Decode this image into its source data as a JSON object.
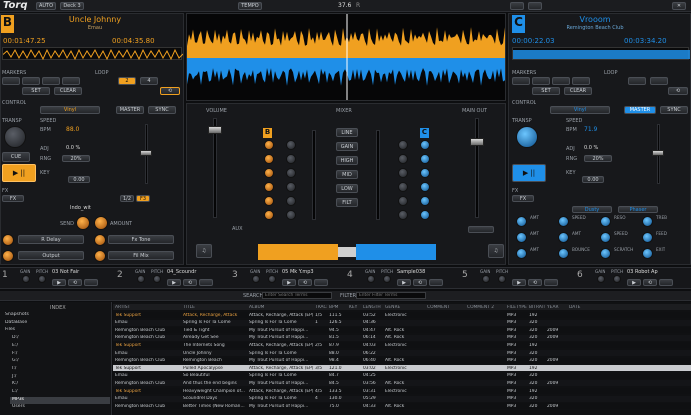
{
  "app": {
    "logo": "Torq",
    "menu": [
      "AUTO",
      "Deck 3"
    ],
    "tempo_label": "TEMPO",
    "bpm_display": "37.6",
    "tempo_sub": "R",
    "colors": {
      "orange": "#f0a020",
      "blue": "#1f8fe8",
      "bg": "#0d0e10"
    }
  },
  "deck_left": {
    "letter": "B",
    "title": "Uncle Johnny",
    "artist": "Emau",
    "elapsed": "00:01:47.25",
    "remaining": "00:04:35.80",
    "remain_suffix": "A ?",
    "markers_label": "MARKERS",
    "loop_label": "LOOP",
    "set_label": "SET",
    "clear_label": "CLEAR",
    "loop_values": [
      "2",
      "4"
    ],
    "control_label": "CONTROL",
    "vinyl": "Vinyl",
    "master": "MASTER",
    "sync": "SYNC",
    "transport_label": "TRANSP",
    "speed_label": "SPEED",
    "bpm_label": "BPM",
    "bpm": "88.0",
    "adj_label": "ADJ",
    "adj": "0.0 %",
    "rng_label": "RNG",
    "rng": "20%",
    "key_label": "KEY",
    "key": "0.00",
    "fx_label": "FX",
    "fx_badges": [
      "FX",
      "1/2",
      "F3"
    ],
    "send_label": "SEND",
    "amount_label": "AMOUNT",
    "fx_preset": "Indo_wit",
    "effects": [
      "R Delay",
      "Fx Tone",
      "Output",
      "Fil Mix"
    ],
    "cue_label": "CUE",
    "play": "▶ ||"
  },
  "deck_right": {
    "letter": "C",
    "title": "Vrooom",
    "artist": "Remington Beach Club",
    "elapsed": "00:00:22.03",
    "remaining": "00:03:34.20",
    "markers_label": "MARKERS",
    "loop_label": "LOOP",
    "set_label": "SET",
    "clear_label": "CLEAR",
    "control_label": "CONTROL",
    "vinyl": "Vinyl",
    "master": "MASTER",
    "sync": "SYNC",
    "transport_label": "TRANSP",
    "speed_label": "SPEED",
    "bpm_label": "BPM",
    "bpm": "71.9",
    "adj_label": "ADJ",
    "adj": "0.0 %",
    "rng_label": "RNG",
    "rng": "20%",
    "key_label": "KEY",
    "key": "0.00",
    "fx_label": "FX",
    "fx_badges": [
      "FX",
      "1/2"
    ],
    "fx_preset": "Dusty",
    "fx_preset2": "Phaser",
    "knob_labels": [
      "AMT",
      "SPEED",
      "RESO",
      "TREB",
      "AMT",
      "AMT",
      "SPEED",
      "FEED",
      "AMT",
      "BOUNCE",
      "SCRATCH",
      "EXIT"
    ],
    "bottom_labels": [
      "MODE",
      "SPEED",
      "DEPTH",
      "SPEED",
      "ROUTE",
      "BOUNCE",
      "RESET",
      "ROUTE",
      "DEPTH",
      "MODE",
      "ROUTE"
    ]
  },
  "mixer": {
    "volume_label": "VOLUME",
    "mixer_label": "MIXER",
    "main_out_label": "MAIN OUT",
    "eq": [
      "LINE",
      "GAIN",
      "HIGH",
      "MID",
      "LOW",
      "FILT"
    ],
    "aux_label": "AUX",
    "left_letter": "B",
    "right_letter": "C"
  },
  "channels": [
    {
      "num": "1",
      "gain": "GAIN",
      "pitch": "PITCH",
      "track": "03 Not Fair"
    },
    {
      "num": "2",
      "gain": "GAIN",
      "pitch": "PITCH",
      "track": "04_Scoundr"
    },
    {
      "num": "3",
      "gain": "GAIN",
      "pitch": "PITCH",
      "track": "05 Mk Y.mp3"
    },
    {
      "num": "4",
      "gain": "GAIN",
      "pitch": "PITCH",
      "track": "Sample038"
    },
    {
      "num": "5",
      "gain": "GAIN",
      "pitch": "PITCH",
      "track": ""
    },
    {
      "num": "6",
      "gain": "GAIN",
      "pitch": "PITCH",
      "track": "03 Robot Ap"
    }
  ],
  "browser": {
    "index_label": "INDEX",
    "search_label": "SEARCH",
    "search_placeholder": "Enter Search Terms",
    "filter_label": "FILTER",
    "filter_placeholder": "Enter Filter Terms",
    "tree": [
      "Snapshots",
      "DataBase",
      "Files",
      "D:/",
      "E:/",
      "F:/",
      "G:/",
      "I:/",
      "J:/",
      "K:/",
      "L:/",
      "MP3s",
      "Users"
    ],
    "columns": [
      "ARTIST",
      "TITLE",
      "ALBUM",
      "TRACK",
      "BPM",
      "KEY",
      "LENGTH",
      "GENRE",
      "COMMENT",
      "COMMENT 2",
      "FILETYPE",
      "BITRATE",
      "YEAR",
      "DATE"
    ],
    "rows": [
      [
        "Tek Support",
        "Attack, Recharge, Attack",
        "Attack, Recharge, Attack (EP)",
        "1/5",
        "111.5",
        "",
        "03:52",
        "Electronic",
        "",
        "",
        "MP3",
        "192",
        "",
        ""
      ],
      [
        "Emau",
        "Spring Is For Ta Come",
        "Spring Is For Ta Come",
        "1",
        "126.5",
        "",
        "04:36",
        "",
        "",
        "",
        "MP3",
        "320",
        "",
        ""
      ],
      [
        "Remington Beach Club",
        "Tied & Tight",
        "My Trout Pursuit of Happi...",
        "",
        "94.5",
        "",
        "04:47",
        "Alt. Rock",
        "",
        "",
        "MP3",
        "320",
        "2009",
        ""
      ],
      [
        "Remington Beach Club",
        "Already Get See",
        "My Trout Pursuit of Happi...",
        "",
        "81.5",
        "",
        "06:14",
        "Alt. Rock",
        "",
        "",
        "MP3",
        "320",
        "2009",
        ""
      ],
      [
        "Tek Support",
        "The Internets Song",
        "Attack, Recharge, Attack (EP)",
        "2/5",
        "87.9",
        "",
        "04:03",
        "Electronic",
        "",
        "",
        "MP3",
        "192",
        "",
        ""
      ],
      [
        "Emau",
        "Uncle Johnny",
        "Spring Is For Ta Come",
        "",
        "88.0",
        "",
        "06:22",
        "",
        "",
        "",
        "MP3",
        "320",
        "",
        ""
      ],
      [
        "Remington Beach Club",
        "Remington Beach",
        "My Trout Pursuit of Happi...",
        "",
        "98.4",
        "",
        "06:40",
        "Alt. Rock",
        "",
        "",
        "MP3",
        "320",
        "2009",
        ""
      ],
      [
        "Tek Support",
        "Pulled Apocalypse",
        "Attack, Recharge, Attack (EP)",
        "3/5",
        "121.0",
        "",
        "03:02",
        "Electronic",
        "",
        "",
        "MP3",
        "192",
        "",
        ""
      ],
      [
        "Emau",
        "So Beautiful",
        "Spring Is For Ta Come",
        "",
        "84.7",
        "",
        "04:25",
        "",
        "",
        "",
        "MP3",
        "320",
        "",
        ""
      ],
      [
        "Remington Beach Club",
        "And thus the end begins",
        "My Trout Pursuit of Happi...",
        "",
        "84.5",
        "",
        "03:56",
        "Alt. Rock",
        "",
        "",
        "MP3",
        "320",
        "2009",
        ""
      ],
      [
        "Tek Support",
        "Heavyweight Champion of...",
        "Attack, Recharge, Attack (EP)",
        "4/5",
        "133.5",
        "",
        "03:31",
        "Electronic",
        "",
        "",
        "MP3",
        "192",
        "",
        ""
      ],
      [
        "Emau",
        "Scoundrel Days",
        "Spring Is For Ta Come",
        "4",
        "130.0",
        "",
        "05:29",
        "",
        "",
        "",
        "MP3",
        "320",
        "",
        ""
      ],
      [
        "Remington Beach Club",
        "Better Times (New Roman...",
        "My Trout Pursuit of Happi...",
        "",
        "75.0",
        "",
        "04:33",
        "Alt. Rock",
        "",
        "",
        "MP3",
        "320",
        "2009",
        ""
      ]
    ],
    "selected_row": 7
  }
}
